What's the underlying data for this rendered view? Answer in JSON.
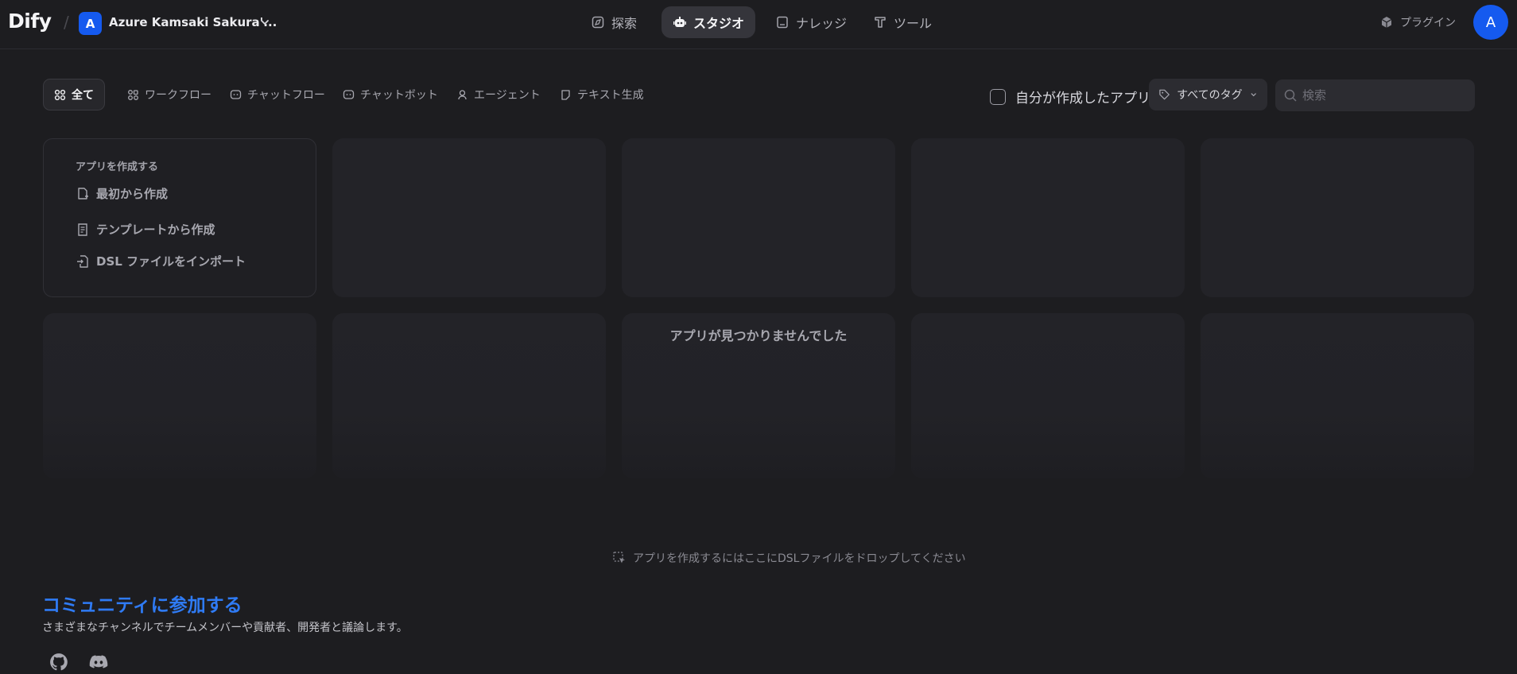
{
  "header": {
    "logo": "Dify",
    "workspace_initial": "A",
    "workspace_name": "Azure Kamsaki Sakura'...",
    "nav": [
      {
        "label": "探索",
        "icon": "compass-icon"
      },
      {
        "label": "スタジオ",
        "icon": "robot-icon"
      },
      {
        "label": "ナレッジ",
        "icon": "book-icon"
      },
      {
        "label": "ツール",
        "icon": "tool-icon"
      }
    ],
    "active_nav": "スタジオ",
    "plugin_label": "プラグイン",
    "avatar_initial": "A"
  },
  "filters": {
    "tabs": [
      {
        "label": "全て",
        "icon": "grid-icon"
      },
      {
        "label": "ワークフロー",
        "icon": "workflow-icon"
      },
      {
        "label": "チャットフロー",
        "icon": "chatflow-icon"
      },
      {
        "label": "チャットボット",
        "icon": "chatbot-icon"
      },
      {
        "label": "エージェント",
        "icon": "agent-icon"
      },
      {
        "label": "テキスト生成",
        "icon": "text-gen-icon"
      }
    ],
    "active_tab": "全て",
    "mine_label": "自分が作成したアプリ",
    "tag_label": "すべてのタグ",
    "search_placeholder": "検索"
  },
  "create": {
    "title": "アプリを作成する",
    "options": [
      {
        "label": "最初から作成",
        "icon": "new-file-icon"
      },
      {
        "label": "テンプレートから作成",
        "icon": "template-icon"
      },
      {
        "label": "DSL ファイルをインポート",
        "icon": "import-icon"
      }
    ]
  },
  "empty_message": "アプリが見つかりませんでした",
  "drop_hint": "アプリを作成するにはここにDSLファイルをドロップしてください",
  "community": {
    "title": "コミュニティに参加する",
    "subtitle": "さまざまなチャンネルでチームメンバーや貢献者、開発者と議論します。",
    "links": [
      "github-icon",
      "discord-icon"
    ]
  },
  "colors": {
    "background": "#1d1d20",
    "accent": "#155aef",
    "link": "#2f7bf5"
  }
}
